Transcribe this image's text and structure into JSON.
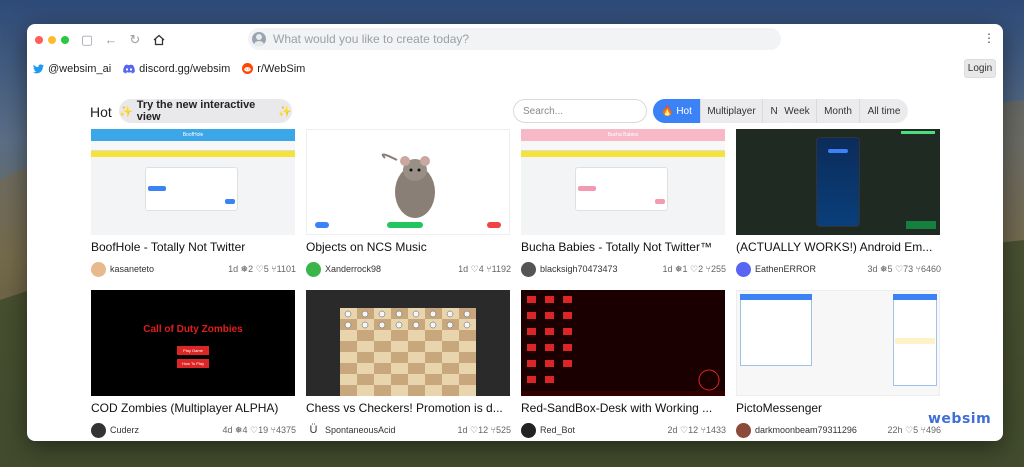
{
  "address_bar": {
    "placeholder": "What would you like to create today?"
  },
  "links": [
    {
      "icon": "twitter-icon",
      "label": "@websim_ai"
    },
    {
      "icon": "discord-icon",
      "label": "discord.gg/websim"
    },
    {
      "icon": "reddit-icon",
      "label": "r/WebSim"
    }
  ],
  "login_label": "Login",
  "section_title": "Hot",
  "try_button": {
    "sparkle": "✨",
    "label": "Try the new interactive view"
  },
  "search_placeholder": "Search...",
  "sort_tabs": [
    "🔥 Hot",
    "Multiplayer",
    "New"
  ],
  "time_tabs": [
    "Week",
    "Month",
    "All time"
  ],
  "accent_color": "#3b82f6",
  "cards": [
    {
      "title": "BoofHole - Totally Not Twitter",
      "user": "kasaneteto",
      "stats": "1d ❅2 ♡5 ⑂1101",
      "thumb_title": "BoofHole"
    },
    {
      "title": "Objects on NCS Music",
      "user": "Xanderrock98",
      "stats": "1d ♡4 ⑂1192"
    },
    {
      "title": "Bucha Babies - Totally Not Twitter™",
      "user": "blacksigh70473473",
      "stats": "1d ❅1 ♡2 ⑂255",
      "thumb_title": "Bucha Babies"
    },
    {
      "title": "(ACTUALLY WORKS!) Android Em...",
      "user": "EathenERROR",
      "stats": "3d ❅5 ♡73 ⑂6460"
    },
    {
      "title": "COD Zombies (Multiplayer ALPHA)",
      "user": "Cuderz",
      "stats": "4d ❅4 ♡19 ⑂4375",
      "thumb_title": "Call of Duty Zombies",
      "thumb_buttons": [
        "Play Game",
        "How To Play"
      ]
    },
    {
      "title": "Chess vs Checkers! Promotion is d...",
      "user": "SpontaneousAcid",
      "stats": "1d ♡12 ⑂525",
      "user_prefix": "Ü"
    },
    {
      "title": "Red-SandBox-Desk with Working ...",
      "user": "Red_Bot",
      "stats": "2d ♡12 ⑂1433"
    },
    {
      "title": "PictoMessenger",
      "user": "darkmoonbeam79311296",
      "stats": "22h ♡5 ⑂496"
    }
  ],
  "watermark": "websim"
}
